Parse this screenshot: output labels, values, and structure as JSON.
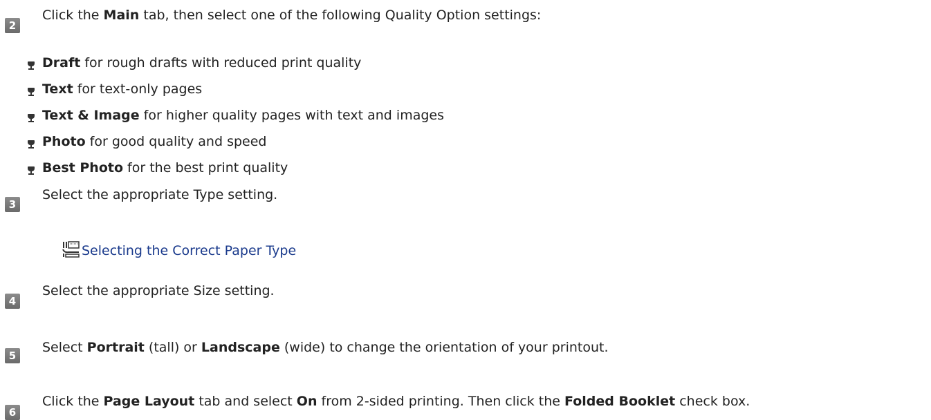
{
  "step2": {
    "number": "2",
    "t1": "Click the ",
    "b1": "Main",
    "t2": " tab, then select one of the following Quality Option settings:"
  },
  "quality_options": [
    {
      "name": "Draft",
      "desc": " for rough drafts with reduced print quality"
    },
    {
      "name": "Text",
      "desc": " for text-only pages"
    },
    {
      "name": "Text & Image",
      "desc": " for higher quality pages with text and images"
    },
    {
      "name": "Photo",
      "desc": " for good quality and speed"
    },
    {
      "name": "Best Photo",
      "desc": " for the best print quality"
    }
  ],
  "step3": {
    "number": "3",
    "text": "Select the appropriate Type setting.",
    "link_icon": "reference-link-icon",
    "link_text": "Selecting the Correct Paper Type"
  },
  "step4": {
    "number": "4",
    "text": "Select the appropriate Size setting."
  },
  "step5": {
    "number": "5",
    "t1": "Select ",
    "b1": "Portrait",
    "t2": " (tall) or ",
    "b2": "Landscape",
    "t3": " (wide) to change the orientation of your printout."
  },
  "step6": {
    "number": "6",
    "t1": "Click the ",
    "b1": "Page Layout",
    "t2": " tab and select ",
    "b2": "On",
    "t3": " from 2-sided printing. Then click the ",
    "b3": "Folded Booklet",
    "t4": " check box."
  },
  "colors": {
    "badge": "#7a7a7a",
    "link": "#1a3a8c",
    "text": "#222222"
  }
}
